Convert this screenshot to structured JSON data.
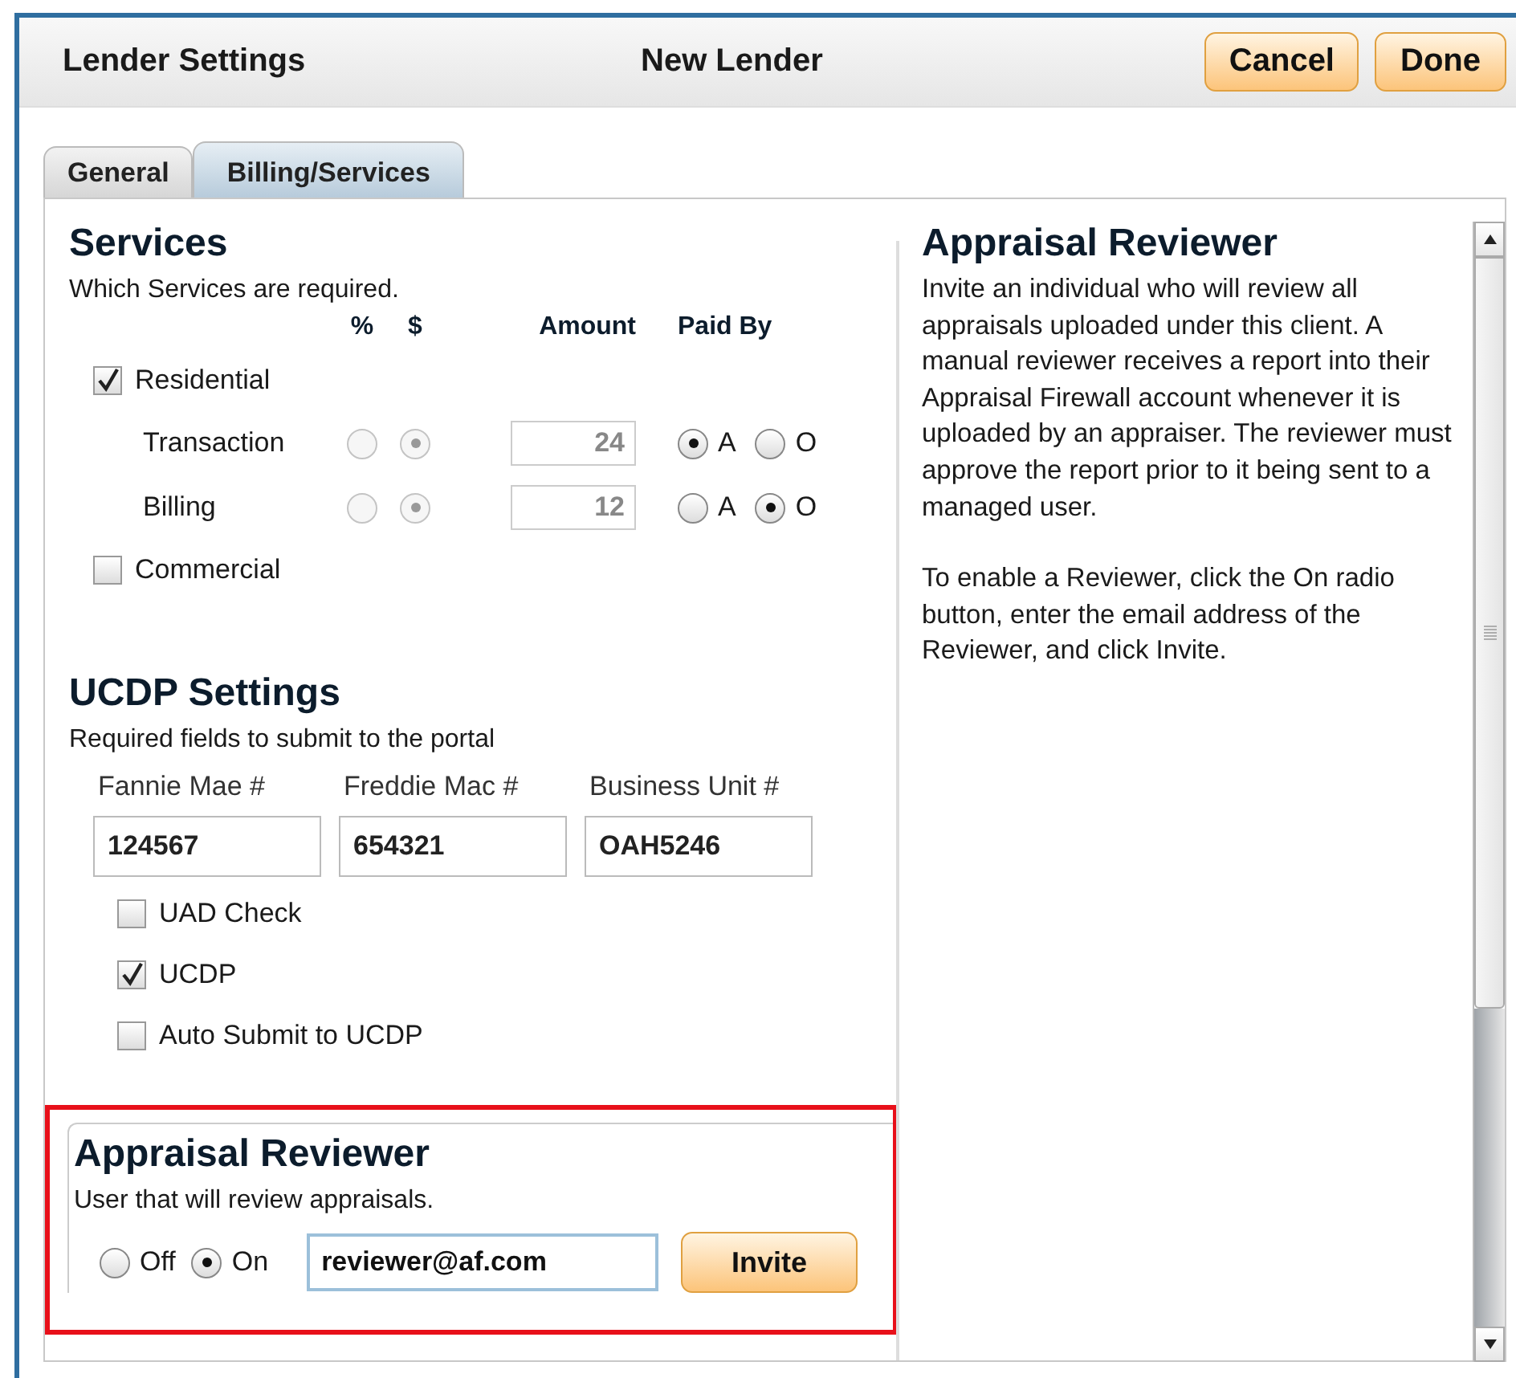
{
  "header": {
    "title": "Lender Settings",
    "subtitle": "New Lender",
    "buttons": [
      "Cancel",
      "Done"
    ]
  },
  "tabs": [
    {
      "label": "General",
      "selected": false
    },
    {
      "label": "Billing/Services",
      "selected": true
    }
  ],
  "services": {
    "title": "Services",
    "subtitle": "Which Services are required.",
    "columns": [
      "%",
      "$",
      "Amount",
      "Paid By"
    ],
    "groups": [
      {
        "label": "Residential",
        "checked": true,
        "rows": [
          {
            "label": "Transaction",
            "disabled": true,
            "rate_type": [
              {
                "selected": false
              },
              {
                "selected": true
              }
            ],
            "amount": "24",
            "paid_by": [
              {
                "label": "A",
                "selected": true
              },
              {
                "label": "O",
                "selected": false
              }
            ]
          },
          {
            "label": "Billing",
            "disabled": true,
            "rate_type": [
              {
                "selected": false
              },
              {
                "selected": true
              }
            ],
            "amount": "12",
            "paid_by": [
              {
                "label": "A",
                "selected": false
              },
              {
                "label": "O",
                "selected": true
              }
            ]
          }
        ]
      },
      {
        "label": "Commercial",
        "checked": false
      }
    ]
  },
  "ucdp": {
    "title": "UCDP Settings",
    "subtitle": "Required fields to submit to the portal",
    "fields": [
      {
        "label": "Fannie Mae #",
        "value": "124567"
      },
      {
        "label": "Freddie Mac #",
        "value": "654321"
      },
      {
        "label": "Business Unit #",
        "value": "OAH5246"
      }
    ],
    "options": [
      {
        "label": "UAD Check",
        "checked": false
      },
      {
        "label": "UCDP",
        "checked": true
      },
      {
        "label": "Auto Submit to UCDP",
        "checked": false
      }
    ]
  },
  "reviewer": {
    "highlighted": true,
    "title": "Appraisal Reviewer",
    "subtitle": "User that will review appraisals.",
    "options": [
      {
        "label": "Off",
        "selected": false
      },
      {
        "label": "On",
        "selected": true
      }
    ],
    "email": "reviewer@af.com",
    "button": "Invite"
  },
  "help": {
    "title": "Appraisal Reviewer",
    "paragraphs": [
      "Invite an individual who will review all appraisals uploaded under this client. A manual reviewer receives a report into their Appraisal Firewall account whenever it is uploaded by an appraiser. The reviewer must approve the report prior to it being sent to a managed user.",
      "To enable a Reviewer, click the On radio button, enter the email address of the Reviewer, and click Invite."
    ]
  }
}
